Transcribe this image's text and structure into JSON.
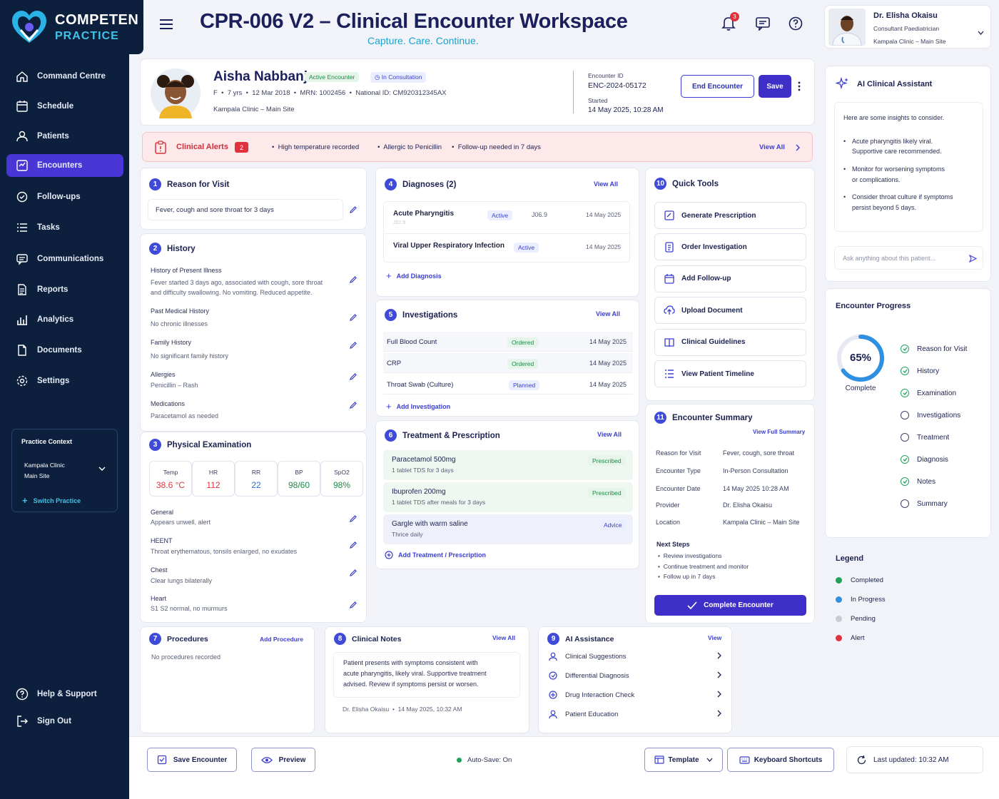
{
  "brand": {
    "name": "COMPETEN",
    "sub": "PRACTICE"
  },
  "nav": {
    "items": [
      "Command Centre",
      "Schedule",
      "Patients",
      "Encounters",
      "Follow-ups",
      "Tasks",
      "Communications",
      "Reports",
      "Analytics",
      "Documents",
      "Settings"
    ],
    "active": "Encounters",
    "help": "Help & Support",
    "signout": "Sign Out"
  },
  "practice_context": {
    "title": "Practice Context",
    "clinic_line1": "Kampala Clinic",
    "clinic_line2": "Main Site",
    "switch": "Switch Practice"
  },
  "header": {
    "title": "CPR-006 V2 – Clinical Encounter Workspace",
    "subtitle": "Capture. Care. Continue.",
    "notif_count": "3",
    "user": {
      "name": "Dr. Elisha Okaisu",
      "role": "Consultant Paediatrician",
      "site": "Kampala Clinic – Main Site"
    }
  },
  "patient": {
    "name": "Aisha Nabbanja",
    "status_badge": "Active Encounter",
    "consult_badge": "In Consultation",
    "sex": "F",
    "age": "7 yrs",
    "dob": "12 Mar 2018",
    "mrn_label": "MRN:",
    "mrn": "1002456",
    "nid_label": "National ID:",
    "nid": "CM920312345AX",
    "clinic": "Kampala Clinic – Main Site",
    "enc_id_label": "Encounter ID",
    "enc_id": "ENC-2024-05172",
    "started_label": "Started",
    "started": "14 May 2025, 10:28 AM",
    "end_btn": "End Encounter",
    "save_btn": "Save"
  },
  "alerts": {
    "title": "Clinical Alerts",
    "count": "2",
    "items": [
      "High temperature recorded",
      "Allergic to Penicillin",
      "Follow-up needed in 7 days"
    ],
    "view_all": "View All"
  },
  "reason": {
    "num": "1",
    "title": "Reason for Visit",
    "text": "Fever, cough and sore throat for 3 days"
  },
  "history": {
    "num": "2",
    "title": "History",
    "hpi_label": "History of Present Illness",
    "hpi_line1": "Fever started 3 days ago, associated with cough, sore throat",
    "hpi_line2": "and difficulty swallowing. No vomiting. Reduced appetite.",
    "pmh_label": "Past Medical History",
    "pmh": "No chronic illnesses",
    "fh_label": "Family History",
    "fh": "No significant family history",
    "allergy_label": "Allergies",
    "allergy": "Penicillin – Rash",
    "med_label": "Medications",
    "med": "Paracetamol as needed"
  },
  "exam": {
    "num": "3",
    "title": "Physical Examination",
    "vitals": [
      {
        "label": "Temp",
        "value": "38.6 °C",
        "color": "#d8383f"
      },
      {
        "label": "HR",
        "value": "112",
        "color": "#d8383f"
      },
      {
        "label": "RR",
        "value": "22",
        "color": "#2f6fd0"
      },
      {
        "label": "BP",
        "value": "98/60",
        "color": "#1f8a48"
      },
      {
        "label": "SpO2",
        "value": "98%",
        "color": "#1f8a48"
      }
    ],
    "general_label": "General",
    "general": "Appears unwell, alert",
    "heent_label": "HEENT",
    "heent": "Throat erythematous, tonsils enlarged, no exudates",
    "chest_label": "Chest",
    "chest": "Clear lungs bilaterally",
    "heart_label": "Heart",
    "heart": "S1 S2 normal, no murmurs"
  },
  "diagnoses": {
    "num": "4",
    "title": "Diagnoses (2)",
    "view_all": "View All",
    "rows": [
      {
        "name": "Acute Pharyngitis",
        "code_sub": "J02.9",
        "status": "Active",
        "code": "J06.9",
        "date": "14 May 2025"
      },
      {
        "name": "Viral Upper Respiratory Infection",
        "status": "Active",
        "date": "14 May 2025"
      }
    ],
    "add": "Add Diagnosis"
  },
  "investigations": {
    "num": "5",
    "title": "Investigations",
    "view_all": "View All",
    "rows": [
      {
        "name": "Full Blood Count",
        "status": "Ordered",
        "date": "14 May 2025"
      },
      {
        "name": "CRP",
        "status": "Ordered",
        "date": "14 May 2025"
      },
      {
        "name": "Throat Swab (Culture)",
        "status": "Planned",
        "date": "14 May 2025"
      }
    ],
    "add": "Add Investigation"
  },
  "treatment": {
    "num": "6",
    "title": "Treatment & Prescription",
    "view_all": "View All",
    "rows": [
      {
        "name": "Paracetamol 500mg",
        "detail": "1 tablet TDS for 3 days",
        "status": "Prescribed"
      },
      {
        "name": "Ibuprofen 200mg",
        "detail": "1 tablet TDS after meals for 3 days",
        "status": "Prescribed"
      },
      {
        "name": "Gargle with warm saline",
        "detail": "Thrice daily",
        "status": "Advice"
      }
    ],
    "add": "Add Treatment / Prescription"
  },
  "procedures": {
    "num": "7",
    "title": "Procedures",
    "add": "Add Procedure",
    "empty": "No procedures recorded"
  },
  "notes": {
    "num": "8",
    "title": "Clinical Notes",
    "view_all": "View All",
    "line1": "Patient presents with symptoms consistent with",
    "line2": "acute pharyngitis, likely viral. Supportive treatment",
    "line3": "advised. Review if symptoms persist or worsen.",
    "author": "Dr. Elisha Okaisu",
    "time": "14 May 2025, 10:32 AM"
  },
  "ai_assist": {
    "num": "9",
    "title": "AI Assistance",
    "view": "View",
    "items": [
      "Clinical Suggestions",
      "Differential Diagnosis",
      "Drug Interaction Check",
      "Patient Education"
    ]
  },
  "quick_tools": {
    "num": "10",
    "title": "Quick Tools",
    "items": [
      "Generate Prescription",
      "Order Investigation",
      "Add Follow-up",
      "Upload Document",
      "Clinical Guidelines",
      "View Patient Timeline"
    ]
  },
  "summary": {
    "num": "11",
    "title": "Encounter Summary",
    "view_full": "View Full Summary",
    "rows": [
      {
        "k": "Reason for Visit",
        "v": "Fever, cough, sore throat"
      },
      {
        "k": "Encounter Type",
        "v": "In-Person Consultation"
      },
      {
        "k": "Encounter Date",
        "v": "14 May 2025 10:28 AM"
      },
      {
        "k": "Provider",
        "v": "Dr. Elisha Okaisu"
      },
      {
        "k": "Location",
        "v": "Kampala Clinic – Main Site"
      }
    ],
    "next_title": "Next Steps",
    "next": [
      "Review investigations",
      "Continue treatment and monitor",
      "Follow up in 7 days"
    ],
    "complete_btn": "Complete Encounter"
  },
  "ai_panel": {
    "title": "AI Clinical Assistant",
    "intro": "Here are some insights to consider.",
    "b1_l1": "Acute pharyngitis likely viral.",
    "b1_l2": "Supportive care recommended.",
    "b2_l1": "Monitor for worsening symptoms",
    "b2_l2": "or complications.",
    "b3_l1": "Consider throat culture if symptoms",
    "b3_l2": "persist beyond 5 days.",
    "placeholder": "Ask anything about this patient..."
  },
  "progress": {
    "title": "Encounter Progress",
    "percent": 65,
    "percent_label": "65%",
    "complete_label": "Complete",
    "steps": [
      {
        "label": "Reason for Visit",
        "done": true
      },
      {
        "label": "History",
        "done": true
      },
      {
        "label": "Examination",
        "done": true
      },
      {
        "label": "Investigations",
        "done": false
      },
      {
        "label": "Treatment",
        "done": false
      },
      {
        "label": "Diagnosis",
        "done": true
      },
      {
        "label": "Notes",
        "done": true
      },
      {
        "label": "Summary",
        "done": false
      }
    ]
  },
  "legend": {
    "title": "Legend",
    "items": [
      {
        "label": "Completed",
        "color": "#1fa35a"
      },
      {
        "label": "In Progress",
        "color": "#2f8fe0"
      },
      {
        "label": "Pending",
        "color": "#c8cbd6"
      },
      {
        "label": "Alert",
        "color": "#e0323d"
      }
    ]
  },
  "footer": {
    "save": "Save Encounter",
    "preview": "Preview",
    "autosave": "Auto-Save: On",
    "template": "Template",
    "shortcuts": "Keyboard Shortcuts",
    "updated": "Last updated: 10:32 AM"
  },
  "colors": {
    "accent": "#4a35d6",
    "navy": "#0c1f3c",
    "alert_bg": "#fde8ea",
    "alert_red": "#e0323d",
    "green": "#1fa35a"
  }
}
